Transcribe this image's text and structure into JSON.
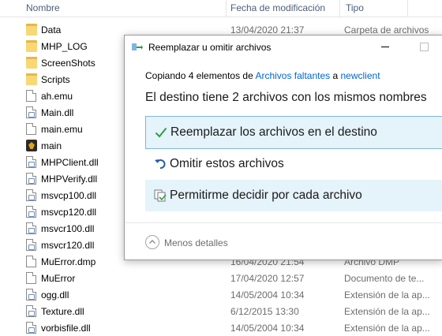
{
  "explorer": {
    "columns": {
      "name": "Nombre",
      "date": "Fecha de modificación",
      "type": "Tipo"
    },
    "rows": [
      {
        "name": "Data",
        "icon": "folder-icon",
        "date": "13/04/2020 21:37",
        "type": "Carpeta de archivos"
      },
      {
        "name": "MHP_LOG",
        "icon": "folder-icon",
        "date": "",
        "type": ""
      },
      {
        "name": "ScreenShots",
        "icon": "folder-icon",
        "date": "",
        "type": ""
      },
      {
        "name": "Scripts",
        "icon": "folder-icon",
        "date": "",
        "type": ""
      },
      {
        "name": "ah.emu",
        "icon": "file-icon",
        "date": "",
        "type": ""
      },
      {
        "name": "Main.dll",
        "icon": "dll-file-icon",
        "date": "",
        "type": ""
      },
      {
        "name": "main.emu",
        "icon": "file-icon",
        "date": "",
        "type": ""
      },
      {
        "name": "main",
        "icon": "app-exe-icon",
        "date": "",
        "type": ""
      },
      {
        "name": "MHPClient.dll",
        "icon": "dll-file-icon",
        "date": "",
        "type": ""
      },
      {
        "name": "MHPVerify.dll",
        "icon": "dll-file-icon",
        "date": "",
        "type": ""
      },
      {
        "name": "msvcp100.dll",
        "icon": "dll-file-icon",
        "date": "",
        "type": ""
      },
      {
        "name": "msvcp120.dll",
        "icon": "dll-file-icon",
        "date": "",
        "type": ""
      },
      {
        "name": "msvcr100.dll",
        "icon": "dll-file-icon",
        "date": "",
        "type": ""
      },
      {
        "name": "msvcr120.dll",
        "icon": "dll-file-icon",
        "date": "",
        "type": ""
      },
      {
        "name": "MuError.dmp",
        "icon": "file-icon",
        "date": "16/04/2020 21:54",
        "type": "Archivo DMP"
      },
      {
        "name": "MuError",
        "icon": "file-icon",
        "date": "17/04/2020 12:57",
        "type": "Documento de te..."
      },
      {
        "name": "ogg.dll",
        "icon": "dll-file-icon",
        "date": "14/05/2004 10:34",
        "type": "Extensión de la ap..."
      },
      {
        "name": "Texture.dll",
        "icon": "dll-file-icon",
        "date": "6/12/2015 13:30",
        "type": "Extensión de la ap..."
      },
      {
        "name": "vorbisfile.dll",
        "icon": "dll-file-icon",
        "date": "14/05/2004 10:34",
        "type": "Extensión de la ap..."
      }
    ]
  },
  "dialog": {
    "title": "Reemplazar u omitir archivos",
    "copying_prefix": "Copiando 4 elementos de ",
    "source": "Archivos faltantes",
    "copying_mid": " a ",
    "destination": "newclient",
    "heading": "El destino tiene 2 archivos con los mismos nombres",
    "options": [
      {
        "label": "Reemplazar los archivos en el destino",
        "icon": "checkmark-icon"
      },
      {
        "label": "Omitir estos archivos",
        "icon": "skip-arrow-icon"
      },
      {
        "label": "Permitirme decidir por cada archivo",
        "icon": "compare-files-icon"
      }
    ],
    "details_label": "Menos detalles",
    "colors": {
      "link": "#0066cc",
      "selected_bg": "#e5f3fb",
      "selected_border": "#7fb6df",
      "check": "#2f9e44"
    }
  }
}
